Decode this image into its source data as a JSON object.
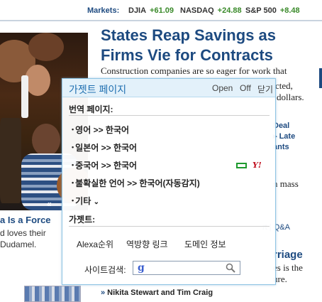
{
  "markets": {
    "label": "Markets:",
    "indices": [
      {
        "name": "DJIA",
        "change": "+61.09"
      },
      {
        "name": "NASDAQ",
        "change": "+24.88"
      },
      {
        "name": "S&P 500",
        "change": "+8.48"
      }
    ]
  },
  "article": {
    "headline": "States Reap Savings as Firms Vie for Contracts",
    "deck": "Construction companies are so eager for work that",
    "deck_fragments": [
      "cted,",
      "dollars."
    ]
  },
  "photo_caption": {
    "title": "a Is a Force",
    "lines": [
      "d loves their",
      "Dudamel."
    ]
  },
  "sidebar": {
    "links": [
      "Deal",
      "▸ Late",
      "ants"
    ],
    "serif_text": "n mass",
    "small_links": "rt | Q&A",
    "big_heading": "rriage",
    "body_lines": [
      "es is the",
      "ure."
    ]
  },
  "byline": "Nikita Stewart and Tim Craig",
  "popup": {
    "title": "가젯트 페이지",
    "open_label": "Open",
    "off_label": "Off",
    "close_label": "닫기",
    "translate_section": "번역 페이지:",
    "languages": [
      "영어  >> 한국어",
      "일본어 >> 한국어",
      "중국어 >> 한국어",
      "불확실한 언어  >> 한국어(자동감지)"
    ],
    "more_label": "기타",
    "gadget_section": "가젯트:",
    "gadgets": [
      "Alexa순위",
      "역방향 링크",
      "도메인 정보"
    ],
    "search_label": "사이트검색:",
    "search_value": "",
    "search_engine_letter": "g",
    "yahoo_label": "Y!"
  },
  "colors": {
    "accent": "#1d4a80",
    "popup_header": "#e3f1fa",
    "popup_border": "#8fc4e4",
    "positive_change": "#3a8a2a"
  }
}
